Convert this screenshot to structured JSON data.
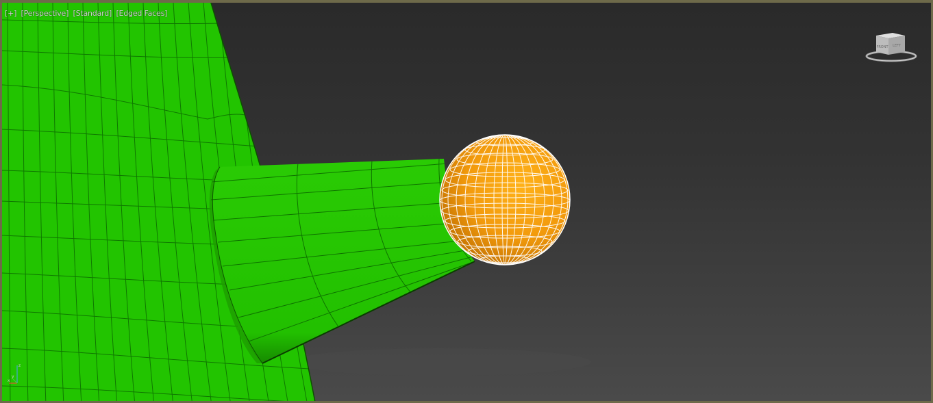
{
  "viewport": {
    "menu_label": "[+]",
    "view_label": "[Perspective]",
    "shading_label": "[Standard]",
    "display_label": "[Edged Faces]"
  },
  "viewcube": {
    "front_face_label": "FRONT",
    "side_face_label": "LEFT"
  },
  "colors": {
    "border": "#6e6a4a",
    "green_mesh": "#22c400",
    "green_wire": "#0c6a00",
    "orange_sphere": "#f29a0c",
    "sphere_wire": "#ffffff"
  },
  "scene_objects": [
    {
      "name": "green-body-mesh",
      "color": "green"
    },
    {
      "name": "green-cylinder-mesh",
      "color": "green"
    },
    {
      "name": "orange-sphere",
      "color": "orange",
      "selected": true
    }
  ]
}
